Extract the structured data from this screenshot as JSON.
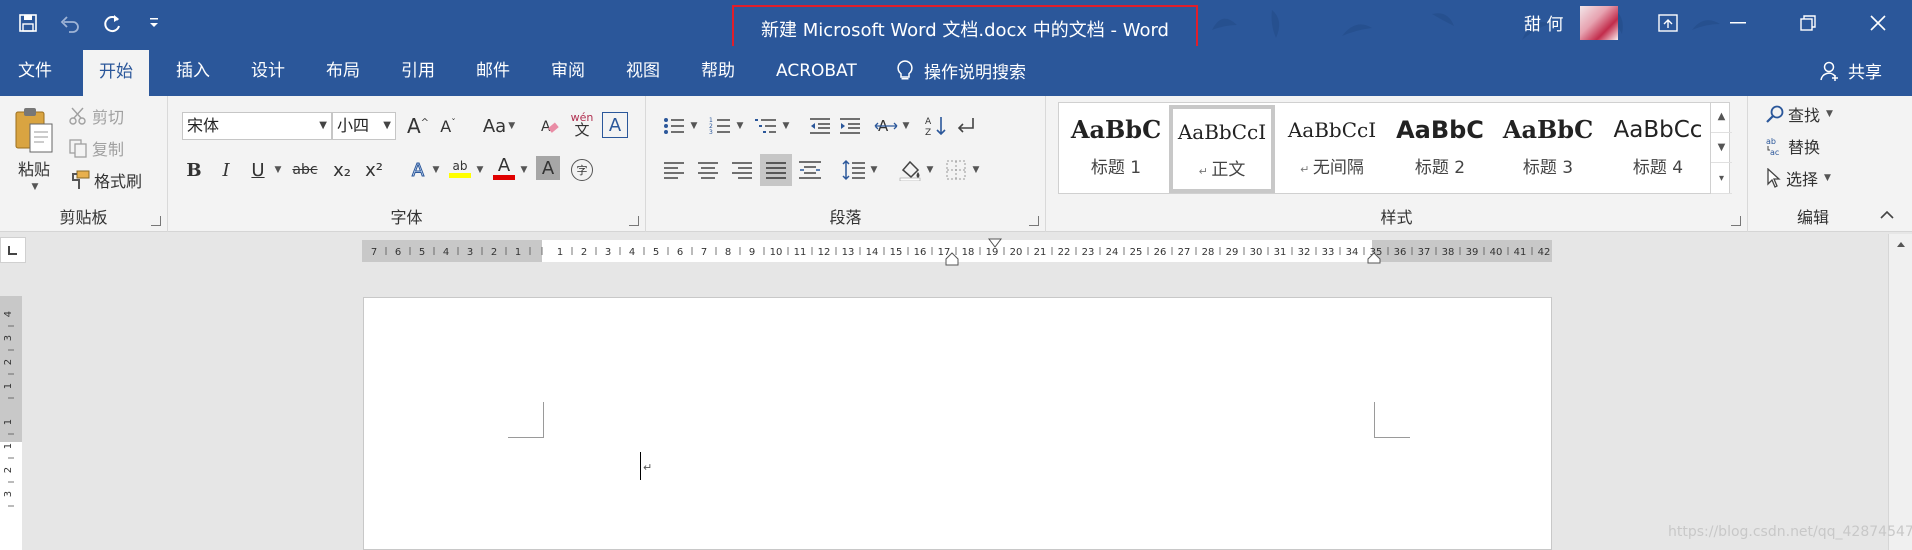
{
  "window": {
    "title": "新建 Microsoft Word 文档.docx 中的文档  -  Word",
    "user": "甜 何",
    "title_highlight_color": "#e01e2b",
    "accent_color": "#2b579a"
  },
  "qat": {
    "save": "save-icon",
    "undo": "undo-icon",
    "redo": "redo-icon",
    "customize": "customize-qat-icon"
  },
  "menu": {
    "tabs": [
      "文件",
      "开始",
      "插入",
      "设计",
      "布局",
      "引用",
      "邮件",
      "审阅",
      "视图",
      "帮助",
      "ACROBAT"
    ],
    "active_tab": "开始",
    "tell_me": "操作说明搜索",
    "share": "共享"
  },
  "clipboard": {
    "paste": "粘贴",
    "cut": "剪切",
    "copy": "复制",
    "format_painter": "格式刷",
    "label": "剪贴板"
  },
  "font": {
    "name": "宋体",
    "size": "小四",
    "change_case": "Aa",
    "phonetic_top": "wén",
    "phonetic_bottom": "文",
    "bold": "B",
    "italic": "I",
    "underline": "U",
    "strikethrough": "abc",
    "subscript": "x₂",
    "superscript": "x²",
    "highlight_text": "ab",
    "label": "字体",
    "enclose": "字"
  },
  "paragraph": {
    "label": "段落"
  },
  "styles": {
    "label": "样式",
    "items": [
      {
        "sample": "AaBbC",
        "name": "标题 1"
      },
      {
        "sample": "AaBbCcI",
        "name": "正文"
      },
      {
        "sample": "AaBbCcI",
        "name": "无间隔"
      },
      {
        "sample": "AaBbC",
        "name": "标题 2"
      },
      {
        "sample": "AaBbC",
        "name": "标题 3"
      },
      {
        "sample": "AaBbCc",
        "name": "标题 4"
      }
    ]
  },
  "editing": {
    "find": "查找",
    "replace": "替换",
    "select": "选择",
    "label": "编辑"
  },
  "ruler": {
    "left_numbers": [
      "7",
      "6",
      "5",
      "4",
      "3",
      "2",
      "1"
    ],
    "right_numbers": [
      "1",
      "2",
      "3",
      "4",
      "5",
      "6",
      "7",
      "8",
      "9",
      "10",
      "11",
      "12",
      "13",
      "14",
      "15",
      "16",
      "17",
      "18",
      "19",
      "20",
      "21",
      "22",
      "23",
      "24",
      "25",
      "26",
      "27",
      "28",
      "29",
      "30",
      "31",
      "32",
      "33",
      "34",
      "35",
      "36",
      "37",
      "38",
      "39",
      "40",
      "41",
      "42"
    ],
    "vertical_numbers": [
      "4",
      "3",
      "2",
      "1",
      "1",
      "1",
      "2",
      "3"
    ]
  },
  "watermark": "https://blog.csdn.net/qq_42874547"
}
